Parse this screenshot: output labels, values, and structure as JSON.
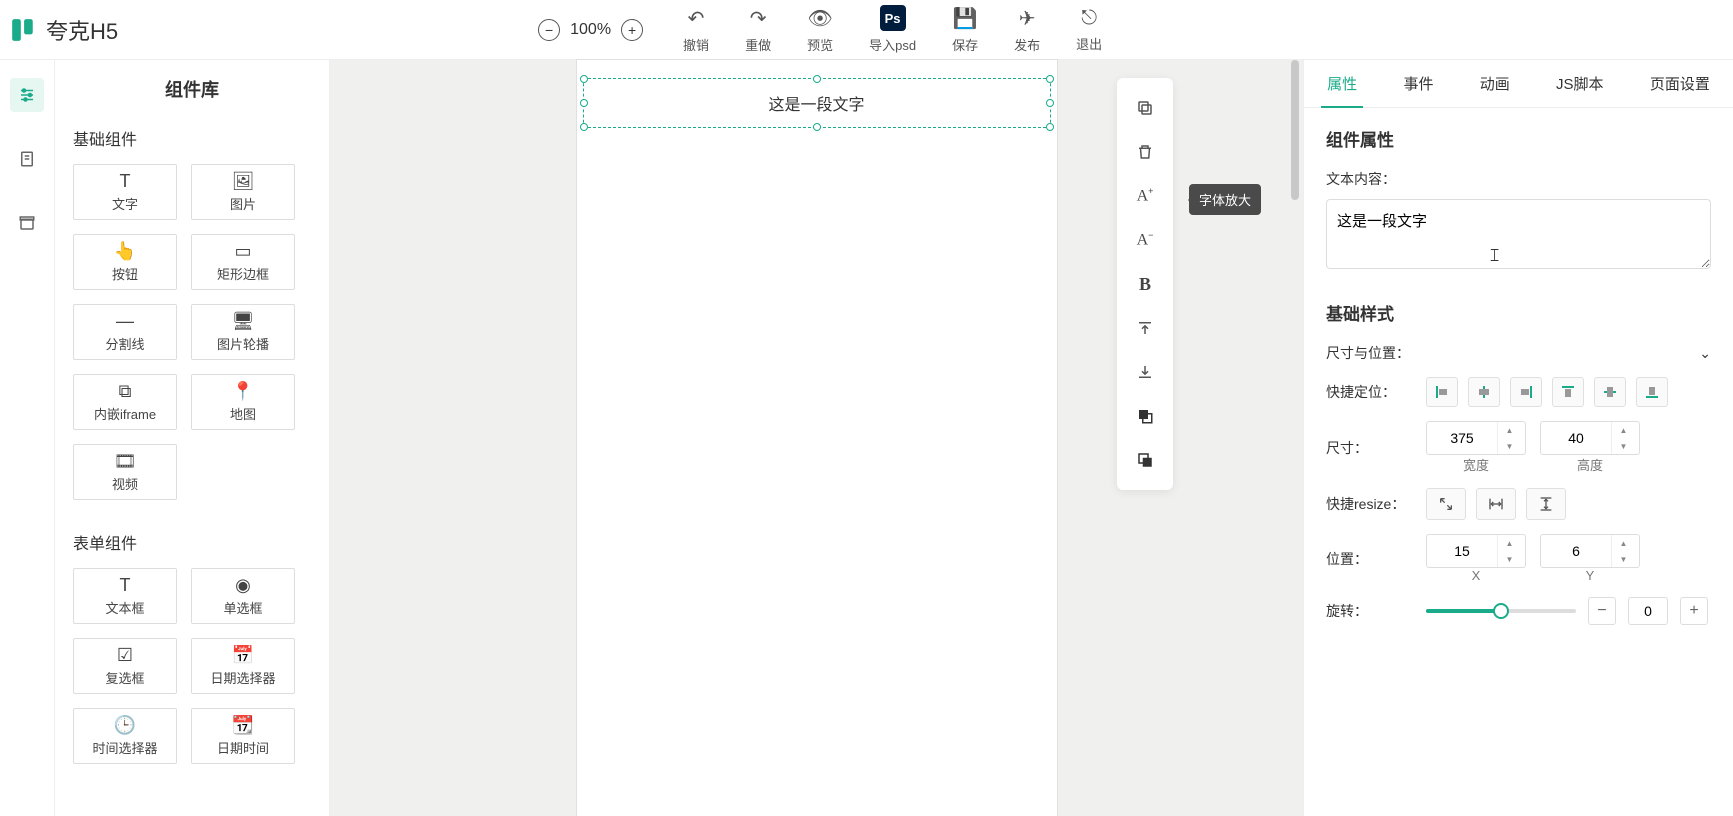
{
  "app": {
    "title": "夸克H5",
    "zoom": "100%"
  },
  "toolbar": {
    "undo": "撤销",
    "redo": "重做",
    "preview": "预览",
    "import_psd": "导入psd",
    "save": "保存",
    "publish": "发布",
    "exit": "退出"
  },
  "library": {
    "title": "组件库",
    "section_basic": "基础组件",
    "section_form": "表单组件",
    "basic": [
      {
        "label": "文字",
        "icon": "T"
      },
      {
        "label": "图片",
        "icon": "🖼"
      },
      {
        "label": "按钮",
        "icon": "👆"
      },
      {
        "label": "矩形边框",
        "icon": "▭"
      },
      {
        "label": "分割线",
        "icon": "—"
      },
      {
        "label": "图片轮播",
        "icon": "🖥"
      },
      {
        "label": "内嵌iframe",
        "icon": "⧉"
      },
      {
        "label": "地图",
        "icon": "📍"
      },
      {
        "label": "视频",
        "icon": "🎞"
      }
    ],
    "form": [
      {
        "label": "文本框",
        "icon": "T"
      },
      {
        "label": "单选框",
        "icon": "◉"
      },
      {
        "label": "复选框",
        "icon": "☑"
      },
      {
        "label": "日期选择器",
        "icon": "📅"
      },
      {
        "label": "时间选择器",
        "icon": "🕒"
      },
      {
        "label": "日期时间",
        "icon": "📆"
      }
    ]
  },
  "canvas": {
    "selected_text": "这是一段文字"
  },
  "float_tools": {
    "tooltip": "字体放大",
    "items": [
      "copy-icon",
      "delete-icon",
      "font-increase-icon",
      "font-decrease-icon",
      "bold-icon",
      "align-top-icon",
      "align-bottom-icon",
      "bring-front-icon",
      "send-back-icon"
    ]
  },
  "inspector": {
    "tabs": [
      "属性",
      "事件",
      "动画",
      "JS脚本",
      "页面设置"
    ],
    "section_props": "组件属性",
    "text_label": "文本内容：",
    "text_value": "这是一段文字",
    "section_style": "基础样式",
    "size_pos_label": "尺寸与位置：",
    "quick_align": "快捷定位：",
    "size_label": "尺寸：",
    "width": "375",
    "width_label": "宽度",
    "height": "40",
    "height_label": "高度",
    "resize_label": "快捷resize：",
    "pos_label": "位置：",
    "x": "15",
    "x_label": "X",
    "y": "6",
    "y_label": "Y",
    "rotate_label": "旋转：",
    "rotate_value": "0"
  }
}
